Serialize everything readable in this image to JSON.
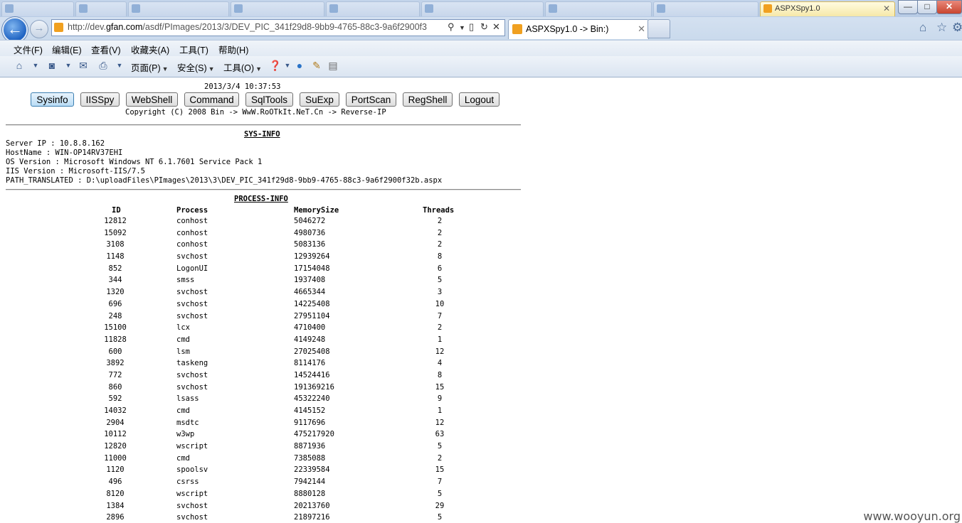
{
  "browser": {
    "url_prefix": "http://dev.",
    "url_domain": "gfan.com",
    "url_suffix": "/asdf/PImages/2013/3/DEV_PIC_341f29d8-9bb9-4765-88c3-9a6f2900f3",
    "tab_title": "ASPXSpy1.0 -> Bin:)",
    "background_tabs": [
      "",
      "",
      "",
      "",
      "",
      "",
      "",
      ""
    ],
    "active_tab_short": "ASPXSpy1.0",
    "window_controls": {
      "minimize": "—",
      "maximize": "□",
      "close": "✕"
    }
  },
  "menu": [
    "文件(F)",
    "编辑(E)",
    "查看(V)",
    "收藏夹(A)",
    "工具(T)",
    "帮助(H)"
  ],
  "command_bar": {
    "page_label": "页面(P)",
    "safety_label": "安全(S)",
    "tools_label": "工具(O)"
  },
  "page": {
    "datetime": "2013/3/4 10:37:53",
    "nav_buttons": [
      "Sysinfo",
      "IISSpy",
      "WebShell",
      "Command",
      "SqlTools",
      "SuExp",
      "PortScan",
      "RegShell",
      "Logout"
    ],
    "copyright": "Copyright (C) 2008 Bin -> WwW.RoOTkIt.NeT.Cn -> Reverse-IP",
    "sys_info_title": "SYS-INFO",
    "sys_info": [
      "Server IP : 10.8.8.162",
      "HostName : WIN-OP14RV37EHI",
      "OS Version : Microsoft Windows NT 6.1.7601 Service Pack 1",
      "IIS Version : Microsoft-IIS/7.5",
      "PATH_TRANSLATED : D:\\uploadFiles\\PImages\\2013\\3\\DEV_PIC_341f29d8-9bb9-4765-88c3-9a6f2900f32b.aspx"
    ],
    "process_info_title": "PROCESS-INFO",
    "process_headers": [
      "ID",
      "Process",
      "MemorySize",
      "Threads"
    ],
    "processes": [
      [
        "12812",
        "conhost",
        "5046272",
        "2"
      ],
      [
        "15092",
        "conhost",
        "4980736",
        "2"
      ],
      [
        "3108",
        "conhost",
        "5083136",
        "2"
      ],
      [
        "1148",
        "svchost",
        "12939264",
        "8"
      ],
      [
        "852",
        "LogonUI",
        "17154048",
        "6"
      ],
      [
        "344",
        "smss",
        "1937408",
        "5"
      ],
      [
        "1320",
        "svchost",
        "4665344",
        "3"
      ],
      [
        "696",
        "svchost",
        "14225408",
        "10"
      ],
      [
        "248",
        "svchost",
        "27951104",
        "7"
      ],
      [
        "15100",
        "lcx",
        "4710400",
        "2"
      ],
      [
        "11828",
        "cmd",
        "4149248",
        "1"
      ],
      [
        "600",
        "lsm",
        "27025408",
        "12"
      ],
      [
        "3892",
        "taskeng",
        "8114176",
        "4"
      ],
      [
        "772",
        "svchost",
        "14524416",
        "8"
      ],
      [
        "860",
        "svchost",
        "191369216",
        "15"
      ],
      [
        "592",
        "lsass",
        "45322240",
        "9"
      ],
      [
        "14032",
        "cmd",
        "4145152",
        "1"
      ],
      [
        "2904",
        "msdtc",
        "9117696",
        "12"
      ],
      [
        "10112",
        "w3wp",
        "475217920",
        "63"
      ],
      [
        "12820",
        "wscript",
        "8871936",
        "5"
      ],
      [
        "11000",
        "cmd",
        "7385088",
        "2"
      ],
      [
        "1120",
        "spoolsv",
        "22339584",
        "15"
      ],
      [
        "496",
        "csrss",
        "7942144",
        "7"
      ],
      [
        "8120",
        "wscript",
        "8880128",
        "5"
      ],
      [
        "1384",
        "svchost",
        "20213760",
        "29"
      ],
      [
        "2896",
        "svchost",
        "21897216",
        "5"
      ]
    ]
  },
  "watermark": "www.wooyun.org",
  "colors": {
    "accent": "#1f63c2",
    "active_tab": "#f6e8a8",
    "chrome": "#c9d9ec"
  }
}
